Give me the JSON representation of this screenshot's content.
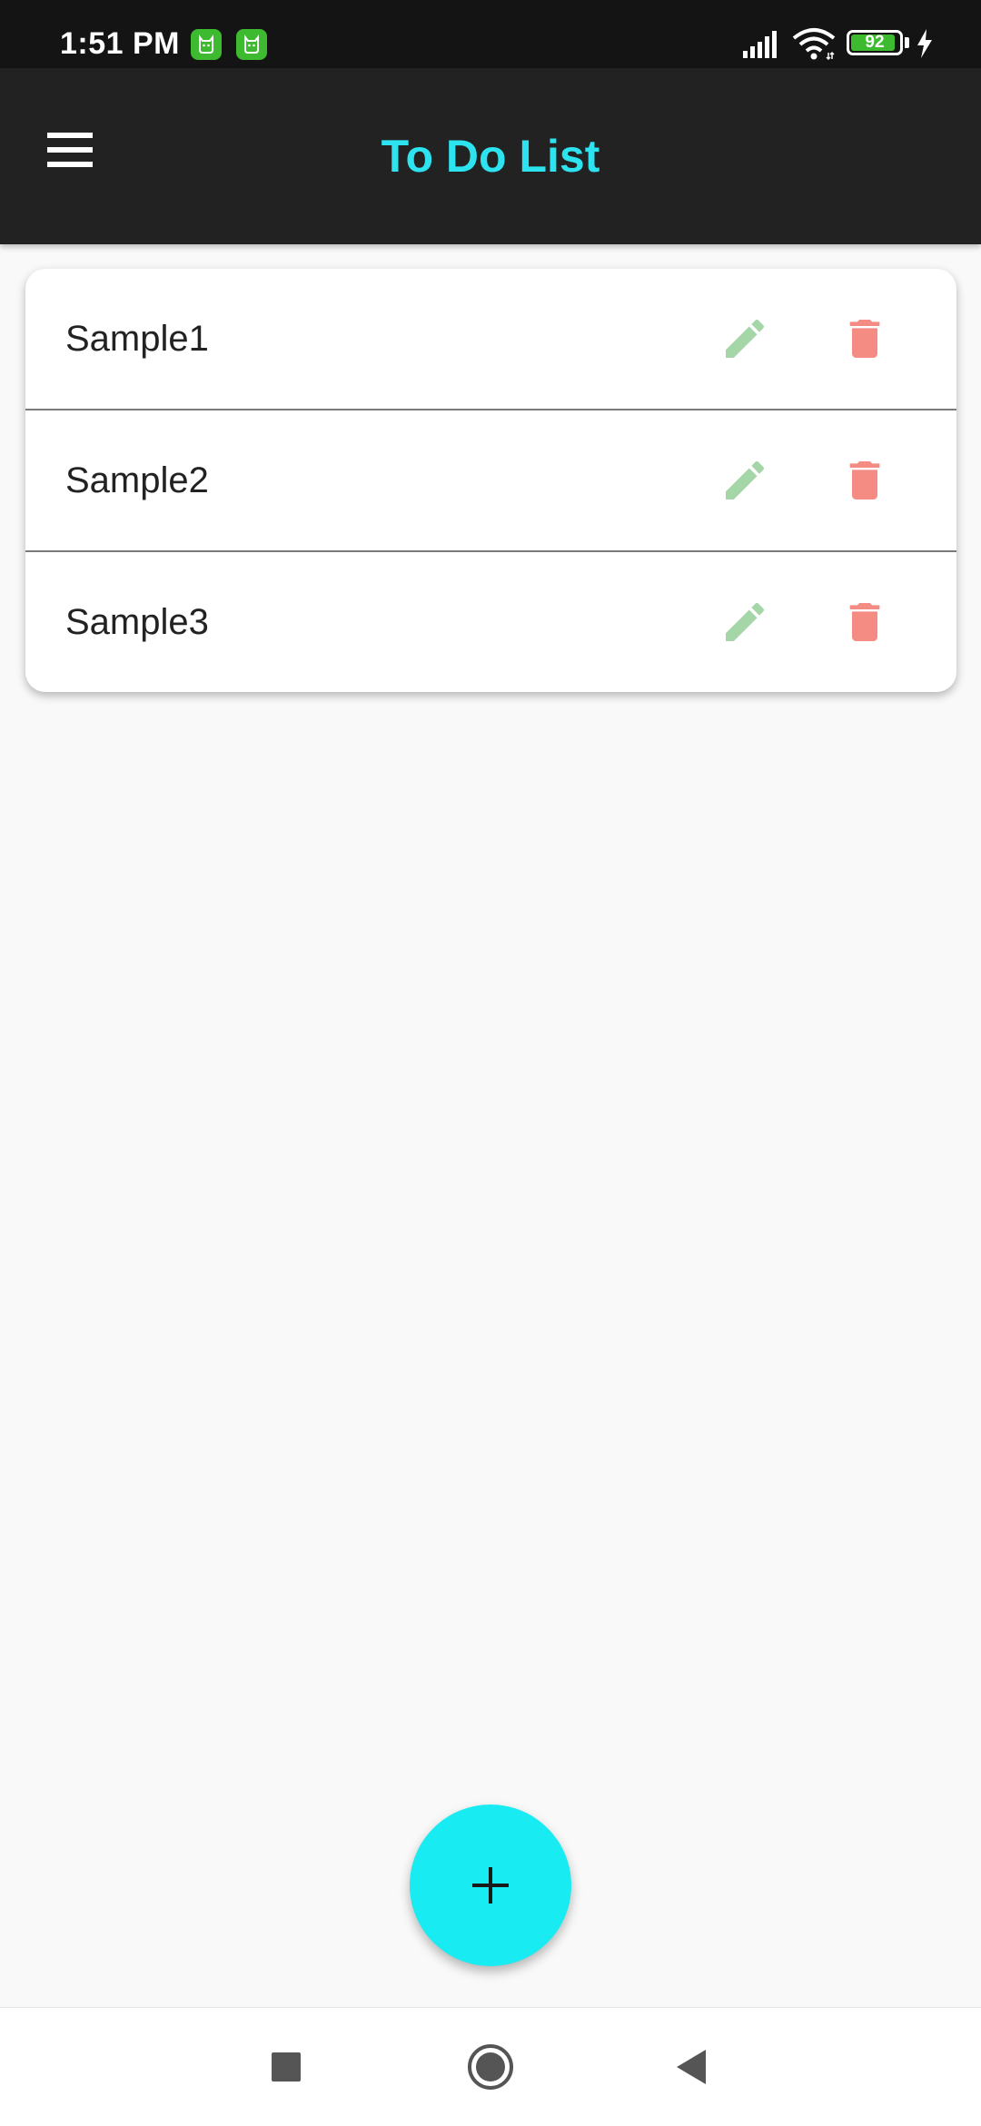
{
  "status_bar": {
    "time": "1:51 PM",
    "notification_icons": [
      "app-notification-icon",
      "app-notification-icon"
    ],
    "battery_level": "92",
    "battery_fraction": 0.92,
    "icons": [
      "signal-icon",
      "wifi-icon",
      "battery-icon",
      "charging-icon"
    ]
  },
  "app_bar": {
    "title": "To Do List",
    "menu_icon": "hamburger-menu-icon"
  },
  "todos": [
    {
      "label": "Sample1"
    },
    {
      "label": "Sample2"
    },
    {
      "label": "Sample3"
    }
  ],
  "item_actions": {
    "edit_icon": "pencil-icon",
    "delete_icon": "trash-icon"
  },
  "fab": {
    "icon": "plus-icon"
  },
  "nav_bar": {
    "buttons": [
      "recents-square-icon",
      "home-circle-icon",
      "back-triangle-icon"
    ]
  },
  "colors": {
    "status_bar_bg": "#141414",
    "app_bar_bg": "#222222",
    "title": "#2ce3ef",
    "edit_icon": "#a5d6a7",
    "delete_icon": "#f48c84",
    "fab": "#18ebf2",
    "notification_badge": "#3dba2f",
    "page_bg": "#f9f9f9"
  }
}
